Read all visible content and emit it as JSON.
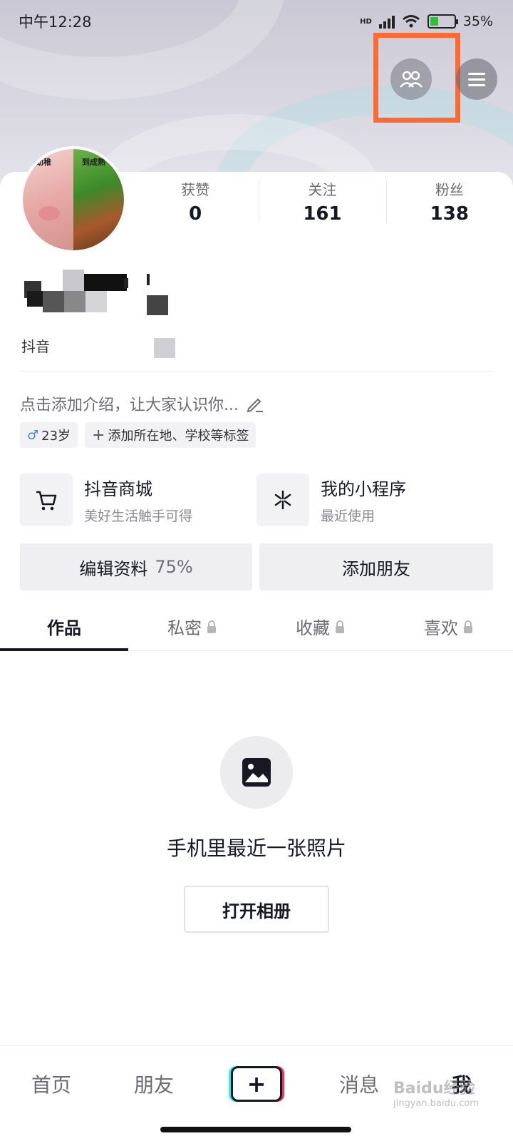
{
  "status_bar": {
    "time": "中午12:28",
    "network": "HD",
    "battery": "35%",
    "battery_level": 0.35
  },
  "header": {
    "friends_icon": "people-icon",
    "menu_icon": "hamburger-menu-icon"
  },
  "profile": {
    "avatar_caption_left": "幼稚",
    "avatar_caption_right": "到成熟",
    "douyin_id_prefix": "抖音",
    "stats": [
      {
        "label": "获赞",
        "value": "0"
      },
      {
        "label": "关注",
        "value": "161"
      },
      {
        "label": "粉丝",
        "value": "138"
      }
    ],
    "bio_placeholder": "点击添加介绍，让大家认识你...",
    "age_tag": "23岁",
    "add_tags": "添加所在地、学校等标签"
  },
  "services": [
    {
      "title": "抖音商城",
      "subtitle": "美好生活触手可得",
      "icon": "cart-icon"
    },
    {
      "title": "我的小程序",
      "subtitle": "最近使用",
      "icon": "mini-program-icon"
    }
  ],
  "actions": {
    "edit_profile": "编辑资料",
    "edit_progress": "75%",
    "add_friends": "添加朋友"
  },
  "tabs": [
    {
      "label": "作品",
      "locked": false
    },
    {
      "label": "私密",
      "locked": true
    },
    {
      "label": "收藏",
      "locked": true
    },
    {
      "label": "喜欢",
      "locked": true
    }
  ],
  "empty_state": {
    "text": "手机里最近一张照片",
    "button": "打开相册"
  },
  "bottom_nav": {
    "home": "首页",
    "friends": "朋友",
    "messages": "消息",
    "me": "我"
  },
  "watermark": {
    "text": "Baidu经验",
    "url": "jingyan.baidu.com"
  },
  "colors": {
    "highlight": "#ff6a33",
    "male": "#3a87e6"
  }
}
